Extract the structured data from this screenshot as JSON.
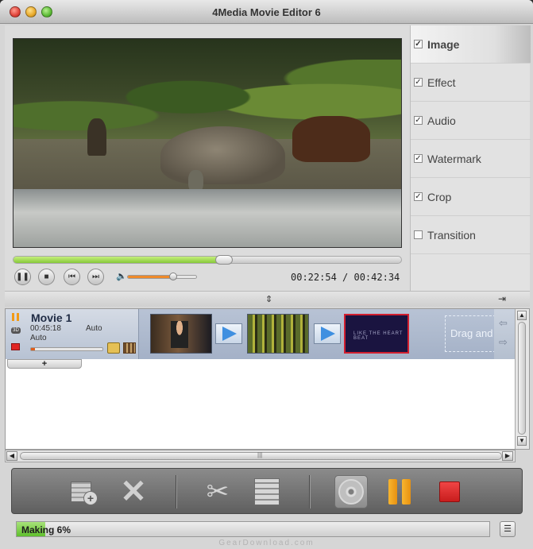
{
  "window": {
    "title": "4Media Movie Editor 6"
  },
  "player": {
    "current_time": "00:22:54",
    "total_time": "00:42:34",
    "progress": 0.54,
    "volume": 0.65
  },
  "tabs": [
    {
      "label": "Image",
      "checked": true,
      "active": true
    },
    {
      "label": "Effect",
      "checked": true,
      "active": false
    },
    {
      "label": "Audio",
      "checked": true,
      "active": false
    },
    {
      "label": "Watermark",
      "checked": true,
      "active": false
    },
    {
      "label": "Crop",
      "checked": true,
      "active": false
    },
    {
      "label": "Transition",
      "checked": false,
      "active": false
    }
  ],
  "movie": {
    "title": "Movie 1",
    "duration": "00:45:18",
    "auto_1": "Auto",
    "auto_2": "Auto",
    "progress": 0.05,
    "add_label": "+"
  },
  "clips": {
    "clip3_text": "LIKE THE HEART BEAT",
    "drag_hint": "Drag and"
  },
  "status": {
    "text": "Making 6%",
    "progress": 0.06
  },
  "footer": {
    "watermark": "GearDownload.com"
  },
  "colors": {
    "progress_green": "#86c93a",
    "stop_red": "#e02424",
    "pause_orange": "#f29a17",
    "accent_blue": "#3f8fe0"
  }
}
